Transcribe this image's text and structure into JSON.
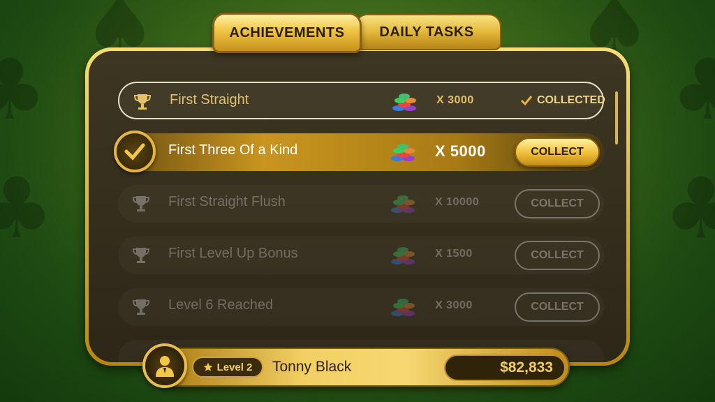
{
  "tabs": [
    {
      "label": "ACHIEVEMENTS",
      "active": true
    },
    {
      "label": "DAILY TASKS",
      "active": false
    }
  ],
  "achievements": [
    {
      "title": "First Straight",
      "reward": "X 3000",
      "status": "collected",
      "status_label": "COLLECTED"
    },
    {
      "title": "First Three Of a Kind",
      "reward": "X 5000",
      "status": "ready",
      "button_label": "COLLECT"
    },
    {
      "title": "First Straight Flush",
      "reward": "X 10000",
      "status": "locked",
      "button_label": "COLLECT"
    },
    {
      "title": "First Level Up Bonus",
      "reward": "X 1500",
      "status": "locked",
      "button_label": "COLLECT"
    },
    {
      "title": "Level 6 Reached",
      "reward": "X 3000",
      "status": "locked",
      "button_label": "COLLECT"
    }
  ],
  "player": {
    "level": "Level 2",
    "name": "Tonny Black",
    "balance": "$82,833"
  },
  "colors": {
    "gold": "#f2c84a",
    "dark_panel": "#2c2718",
    "felt_green": "#3f6a1a"
  },
  "icons": {
    "trophy": "trophy-icon",
    "chips": "poker-chips-icon",
    "check": "checkmark-icon",
    "star": "star-icon",
    "avatar": "user-avatar-icon"
  }
}
